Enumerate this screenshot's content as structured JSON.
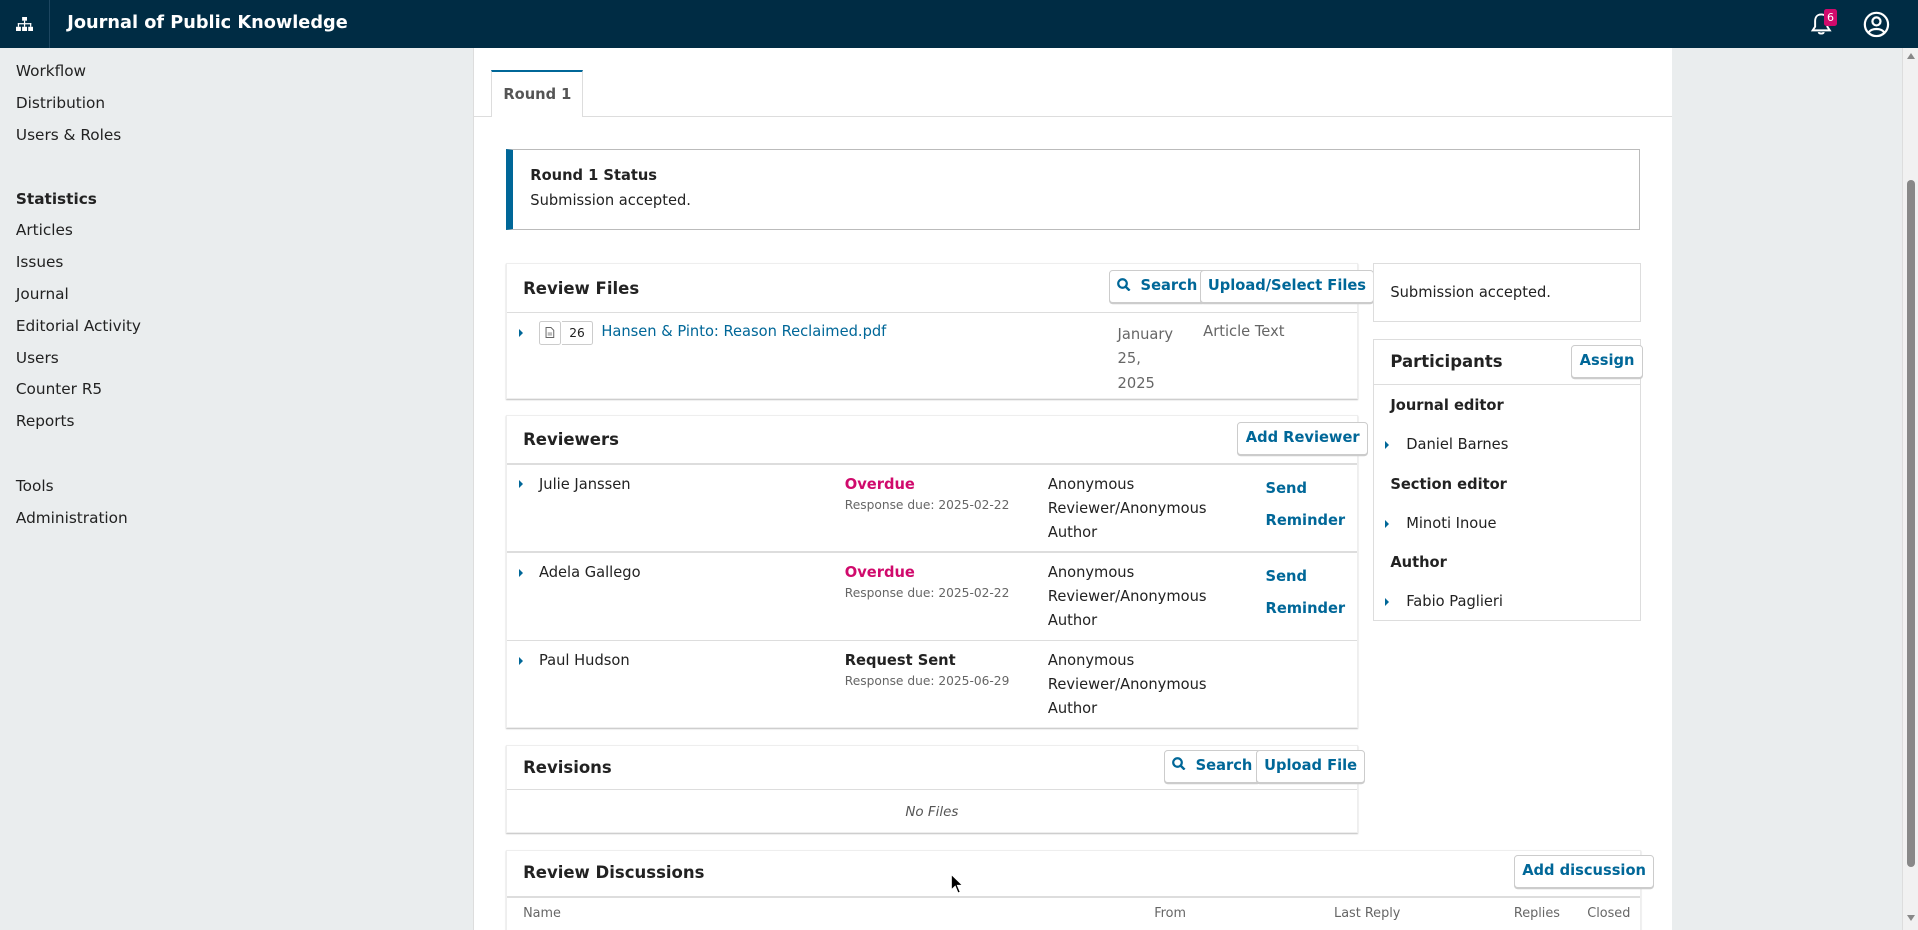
{
  "app": {
    "title": "Journal of Public Knowledge",
    "notification_count": "6"
  },
  "sidebar": {
    "items": [
      {
        "label": "Workflow"
      },
      {
        "label": "Distribution"
      },
      {
        "label": "Users & Roles"
      },
      {
        "label": "Statistics"
      },
      {
        "label": "Articles"
      },
      {
        "label": "Issues"
      },
      {
        "label": "Journal"
      },
      {
        "label": "Editorial Activity"
      },
      {
        "label": "Users"
      },
      {
        "label": "Counter R5"
      },
      {
        "label": "Reports"
      },
      {
        "label": "Tools"
      },
      {
        "label": "Administration"
      }
    ]
  },
  "tabs": {
    "round1": "Round 1"
  },
  "round_status": {
    "heading": "Round 1 Status",
    "text": "Submission accepted."
  },
  "review_files": {
    "title": "Review Files",
    "search_label": "Search",
    "upload_label": "Upload/Select Files",
    "files": [
      {
        "id": "26",
        "name": "Hansen & Pinto: Reason Reclaimed.pdf",
        "date_line1": "January",
        "date_line2": "25,",
        "date_line3": "2025",
        "type": "Article Text"
      }
    ]
  },
  "reviewers": {
    "title": "Reviewers",
    "add_label": "Add Reviewer",
    "rows": [
      {
        "name": "Julie Janssen",
        "status": "Overdue",
        "due": "Response due: 2025-02-22",
        "method_l1": "Anonymous",
        "method_l2": "Reviewer/Anonymous",
        "method_l3": "Author",
        "action_l1": "Send",
        "action_l2": "Reminder"
      },
      {
        "name": "Adela Gallego",
        "status": "Overdue",
        "due": "Response due: 2025-02-22",
        "method_l1": "Anonymous",
        "method_l2": "Reviewer/Anonymous",
        "method_l3": "Author",
        "action_l1": "Send",
        "action_l2": "Reminder"
      },
      {
        "name": "Paul Hudson",
        "status": "Request Sent",
        "due": "Response due: 2025-06-29",
        "method_l1": "Anonymous",
        "method_l2": "Reviewer/Anonymous",
        "method_l3": "Author"
      }
    ]
  },
  "revisions": {
    "title": "Revisions",
    "search_label": "Search",
    "upload_label": "Upload File",
    "empty": "No Files"
  },
  "discussions": {
    "title": "Review Discussions",
    "add_label": "Add discussion",
    "columns": {
      "name": "Name",
      "from": "From",
      "last_reply": "Last Reply",
      "replies": "Replies",
      "closed": "Closed"
    }
  },
  "decision_box": {
    "text": "Submission accepted."
  },
  "participants": {
    "title": "Participants",
    "assign_label": "Assign",
    "groups": [
      {
        "role": "Journal editor",
        "name": "Daniel Barnes"
      },
      {
        "role": "Section editor",
        "name": "Minoti Inoue"
      },
      {
        "role": "Author",
        "name": "Fabio Paglieri"
      }
    ]
  },
  "colors": {
    "header_bg": "#002c44",
    "accent": "#006798",
    "overdue": "#d00a6c"
  }
}
